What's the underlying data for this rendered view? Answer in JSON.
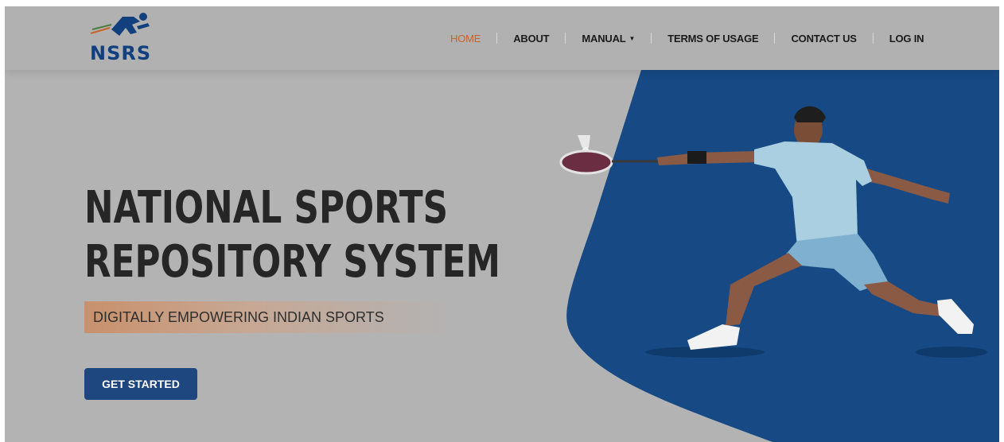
{
  "logo": {
    "text": "NSRS"
  },
  "nav": {
    "items": [
      {
        "label": "HOME",
        "active": true
      },
      {
        "label": "ABOUT"
      },
      {
        "label": "MANUAL",
        "dropdown": true
      },
      {
        "label": "TERMS OF USAGE"
      },
      {
        "label": "CONTACT US"
      },
      {
        "label": "LOG IN"
      }
    ]
  },
  "hero": {
    "title_line1": "NATIONAL SPORTS",
    "title_line2": "REPOSITORY SYSTEM",
    "subtitle": "DIGITALLY EMPOWERING INDIAN SPORTS",
    "cta_label": "GET STARTED"
  },
  "colors": {
    "accent": "#c9622b",
    "brand_blue": "#1e467f",
    "hero_blue": "#174a85",
    "page_gray": "#b3b3b3"
  },
  "icons": [
    "nsrs-logo-runner-icon",
    "caret-down-icon"
  ]
}
